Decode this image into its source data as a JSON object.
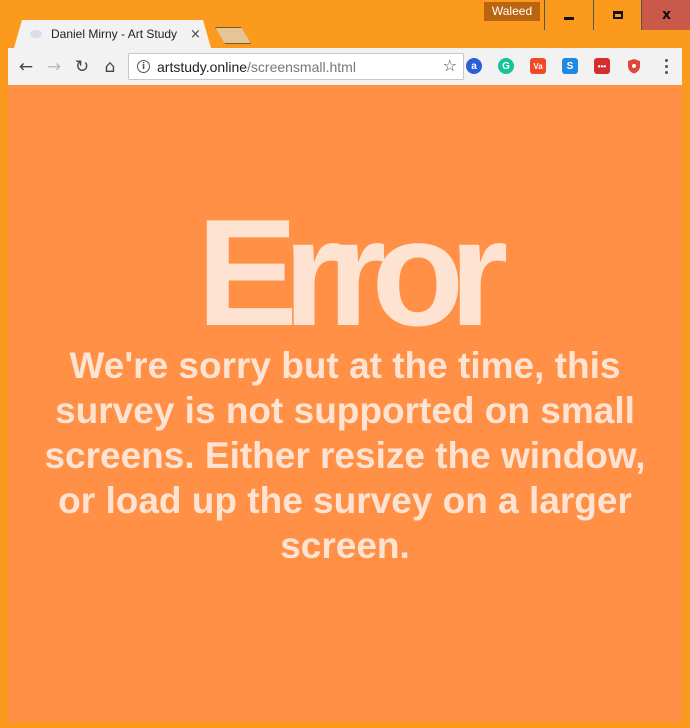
{
  "window": {
    "profile_name": "Waleed",
    "controls": {
      "minimize": "minimize",
      "maximize": "maximize",
      "close": "x"
    }
  },
  "tab": {
    "title": "Daniel Mirny - Art Study",
    "close": "×"
  },
  "toolbar": {
    "back": "←",
    "forward": "→",
    "reload": "↻",
    "home": "⌂",
    "url_host": "artstudy.online",
    "url_path": "/screensmall.html",
    "info": "i",
    "star": "☆"
  },
  "extensions": [
    {
      "name": "a",
      "color": "#2b5fd9"
    },
    {
      "name": "G",
      "color": "#15c39a"
    },
    {
      "name": "Va",
      "color": "#ef4a23"
    },
    {
      "name": "S",
      "color": "#1f8ae0"
    },
    {
      "name": "•••",
      "color": "#d32f2f"
    },
    {
      "name": "shield",
      "color": "#e0463a"
    }
  ],
  "page": {
    "error_title": "Error",
    "error_message": "We're sorry but at the time, this survey is not supported on small screens. Either resize the window, or load up the survey on a larger screen."
  },
  "colors": {
    "frame": "#fc9a1e",
    "page_background": "#ff9045",
    "text": "#fee3d2"
  }
}
